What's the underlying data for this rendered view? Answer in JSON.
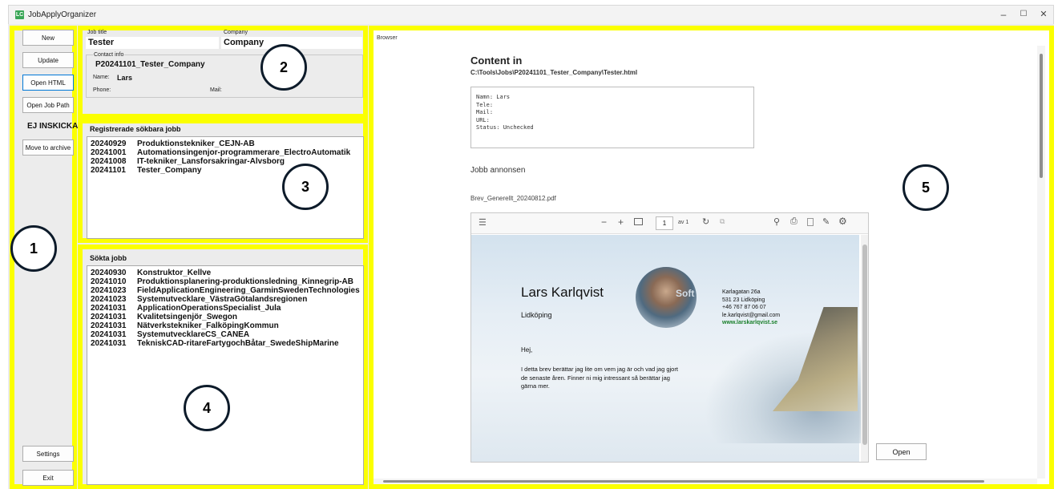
{
  "window": {
    "title": "JobApplyOrganizer",
    "icon_text": "LC",
    "controls": [
      "–",
      "☐",
      "✕"
    ]
  },
  "sidebar": {
    "new": "New",
    "update": "Update",
    "open_html": "Open HTML",
    "open_job_path": "Open Job Path",
    "status": "EJ INSKICKAD",
    "move_to_archive": "Move to archive",
    "settings": "Settings",
    "exit": "Exit"
  },
  "details": {
    "job_title_label": "Job title",
    "job_title_value": "Tester",
    "company_label": "Company",
    "company_value": "Company",
    "contact_info_label": "Contact info",
    "contact_id": "P20241101_Tester_Company",
    "name_label": "Name:",
    "name_value": "Lars",
    "phone_label": "Phone:",
    "mail_label": "Mail:"
  },
  "registered": {
    "title": "Registrerade sökbara jobb",
    "rows": [
      {
        "date": "20240929",
        "name": "Produktionstekniker_CEJN-AB"
      },
      {
        "date": "20241001",
        "name": "Automationsingenjor-programmerare_ElectroAutomatik"
      },
      {
        "date": "20241008",
        "name": "IT-tekniker_Lansforsakringar-Alvsborg"
      },
      {
        "date": "20241101",
        "name": "Tester_Company"
      }
    ]
  },
  "applied": {
    "title": "Sökta jobb",
    "rows": [
      {
        "date": "20240930",
        "name": "Konstruktor_Kellve"
      },
      {
        "date": "20241010",
        "name": "Produktionsplanering-produktionsledning_Kinnegrip-AB"
      },
      {
        "date": "20241023",
        "name": "FieldApplicationEngineering_GarminSwedenTechnologies"
      },
      {
        "date": "20241023",
        "name": "Systemutvecklare_VästraGötalandsregionen"
      },
      {
        "date": "20241031",
        "name": "ApplicationOperationsSpecialist_Jula"
      },
      {
        "date": "20241031",
        "name": "Kvalitetsingenjör_Swegon"
      },
      {
        "date": "20241031",
        "name": "Nätverkstekniker_FalköpingKommun"
      },
      {
        "date": "20241031",
        "name": "SystemutvecklareCS_CANEA"
      },
      {
        "date": "20241031",
        "name": "TekniskCAD-ritareFartygochBåtar_SwedeShipMarine"
      }
    ]
  },
  "browser": {
    "label": "Browser",
    "content_title": "Content in",
    "path": "C:\\Tools\\Jobs\\P20241101_Tester_Company\\Tester.html",
    "info_lines": [
      "Namn: Lars",
      "Tele:",
      "Mail:",
      "URL:",
      "Status: Unchecked"
    ],
    "jobb_heading": "Jobb annonsen",
    "pdf_name": "Brev_Generellt_20240812.pdf",
    "open_button": "Open"
  },
  "pdf": {
    "page_number": "1",
    "page_of": "av 1",
    "person_name": "Lars Karlqvist",
    "city": "Lidköping",
    "address_lines": [
      "Karlagatan 26a",
      "531 23 Lidköping",
      "+46 767 87 06 07",
      "le.karlqvist@gmail.com"
    ],
    "website": "www.larskarlqvist.se",
    "greeting": "Hej,",
    "body_lines": [
      "I detta brev berättar jag lite om vem jag är och vad jag gjort",
      "de senaste åren. Finner ni mig intressant så berättar jag",
      "gärna mer."
    ],
    "photo_text": "Soft"
  },
  "callouts": [
    "1",
    "2",
    "3",
    "4",
    "5"
  ],
  "colors": {
    "highlight": "#fbff00",
    "accent": "#0078d7",
    "link_green": "#1a7f2a"
  }
}
